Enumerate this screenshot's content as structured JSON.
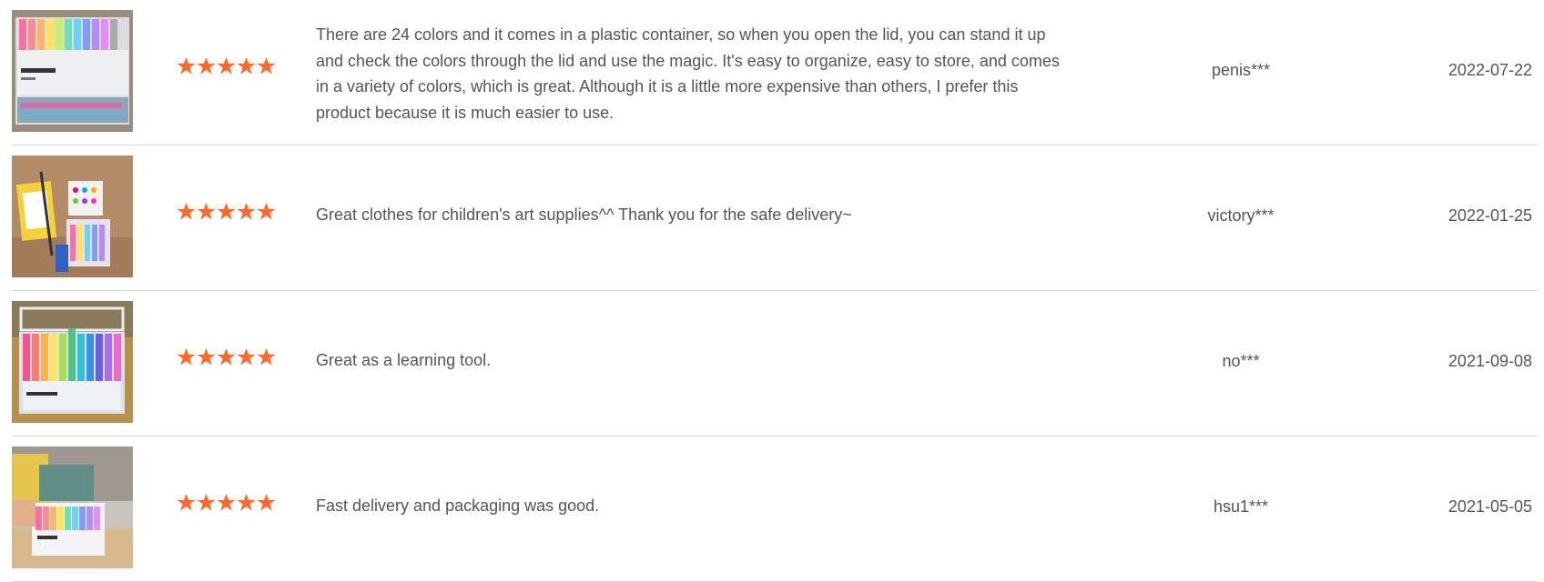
{
  "accent_star_color": "#ff6a2b",
  "reviews": [
    {
      "image_icon": "product-photo-marker-box",
      "rating": 5,
      "text": "There are 24 colors and it comes in a plastic container, so when you open the lid, you can stand it up and check the colors through the lid and use the magic. It's easy to organize, easy to store, and comes in a variety of colors, which is great. Although it is a little more expensive than others, I prefer this product because it is much easier to use.",
      "user": "penis***",
      "date": "2022-07-22"
    },
    {
      "image_icon": "product-photo-art-supplies",
      "rating": 5,
      "text": "Great clothes for children's art supplies^^ Thank you for the safe delivery~",
      "user": "victory***",
      "date": "2022-01-25"
    },
    {
      "image_icon": "product-photo-open-case",
      "rating": 5,
      "text": "Great as a learning tool.",
      "user": "no***",
      "date": "2021-09-08"
    },
    {
      "image_icon": "product-photo-package",
      "rating": 5,
      "text": "Fast delivery and packaging was good.",
      "user": "hsu1***",
      "date": "2021-05-05"
    }
  ]
}
